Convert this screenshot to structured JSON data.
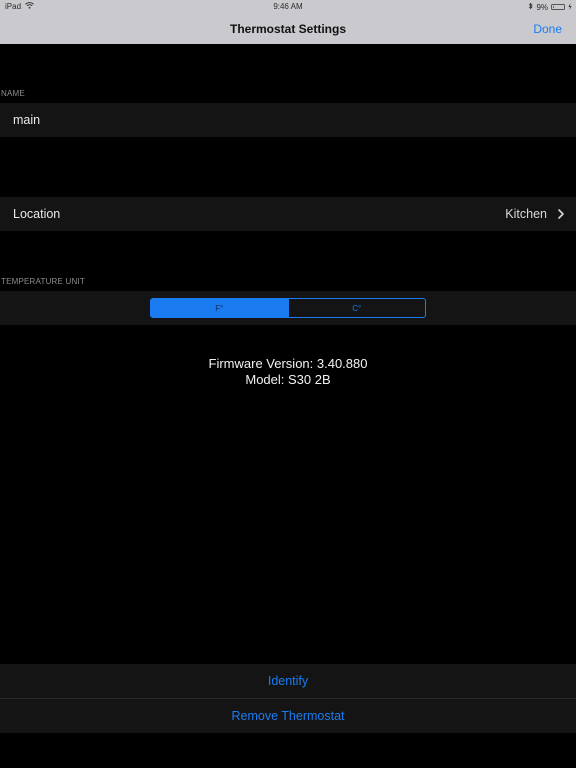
{
  "status_bar": {
    "device": "iPad",
    "time": "9:46 AM",
    "battery": "9%",
    "wifi_icon": "wifi-icon",
    "bluetooth_icon": "bluetooth-icon",
    "battery_icon": "battery-icon",
    "charging_icon": "charging-bolt-icon",
    "battery_level": 0.09
  },
  "nav": {
    "title": "Thermostat Settings",
    "done_label": "Done"
  },
  "name_section": {
    "header": "NAME",
    "value": "main"
  },
  "location_cell": {
    "label": "Location",
    "value": "Kitchen",
    "icon": "chevron-right-icon"
  },
  "temperature_section": {
    "header": "TEMPERATURE UNIT",
    "options": [
      "F°",
      "C°"
    ],
    "selected": "F°"
  },
  "device_info": {
    "firmware": "Firmware Version: 3.40.880",
    "model": "Model: S30 2B"
  },
  "actions": {
    "identify_label": "Identify",
    "remove_label": "Remove Thermostat"
  },
  "colors": {
    "accent": "#1b7cf2",
    "background": "#000000",
    "cell_background": "#141414",
    "nav_background": "#c9c9ce",
    "battery_low": "#e0302c"
  }
}
